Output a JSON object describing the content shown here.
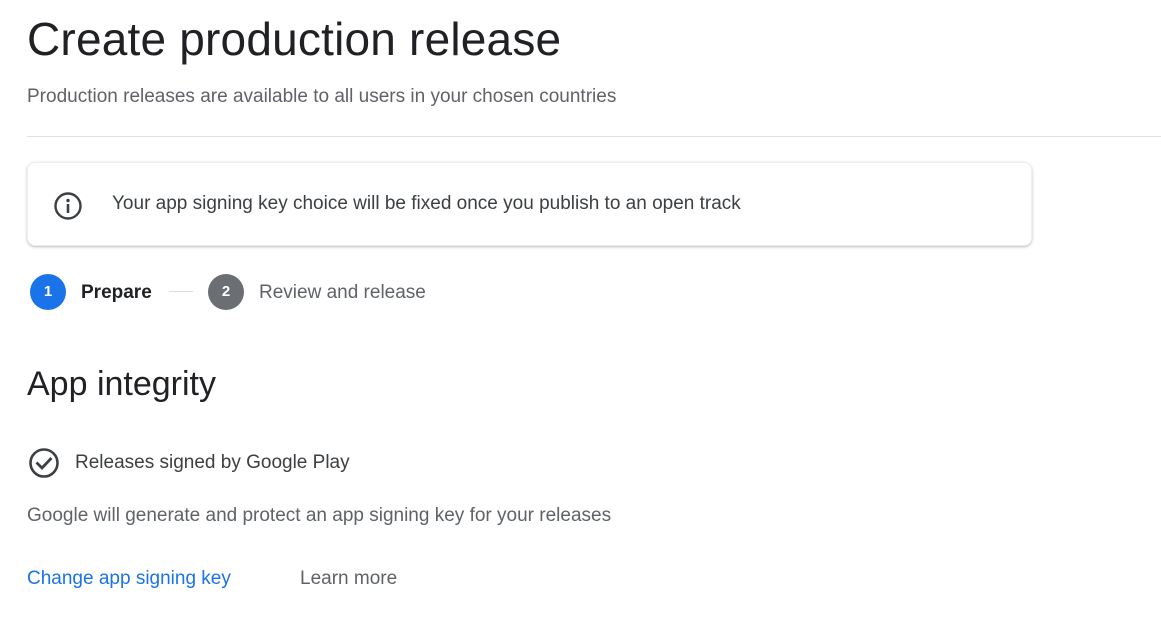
{
  "header": {
    "title": "Create production release",
    "subtitle": "Production releases are available to all users in your chosen countries"
  },
  "banner": {
    "icon": "info-icon",
    "message": "Your app signing key choice will be fixed once you publish to an open track"
  },
  "stepper": {
    "steps": [
      {
        "number": "1",
        "label": "Prepare",
        "state": "active"
      },
      {
        "number": "2",
        "label": "Review and release",
        "state": "inactive"
      }
    ]
  },
  "app_integrity": {
    "title": "App integrity",
    "signing_status": {
      "icon": "check-circle-icon",
      "label": "Releases signed by Google Play"
    },
    "description": "Google will generate and protect an app signing key for your releases",
    "actions": {
      "change_key": "Change app signing key",
      "learn_more": "Learn more"
    }
  },
  "colors": {
    "accent": "#1a73e8",
    "inactive_step": "#6b6e72",
    "text_primary": "#202124",
    "text_secondary": "#5f6368"
  }
}
